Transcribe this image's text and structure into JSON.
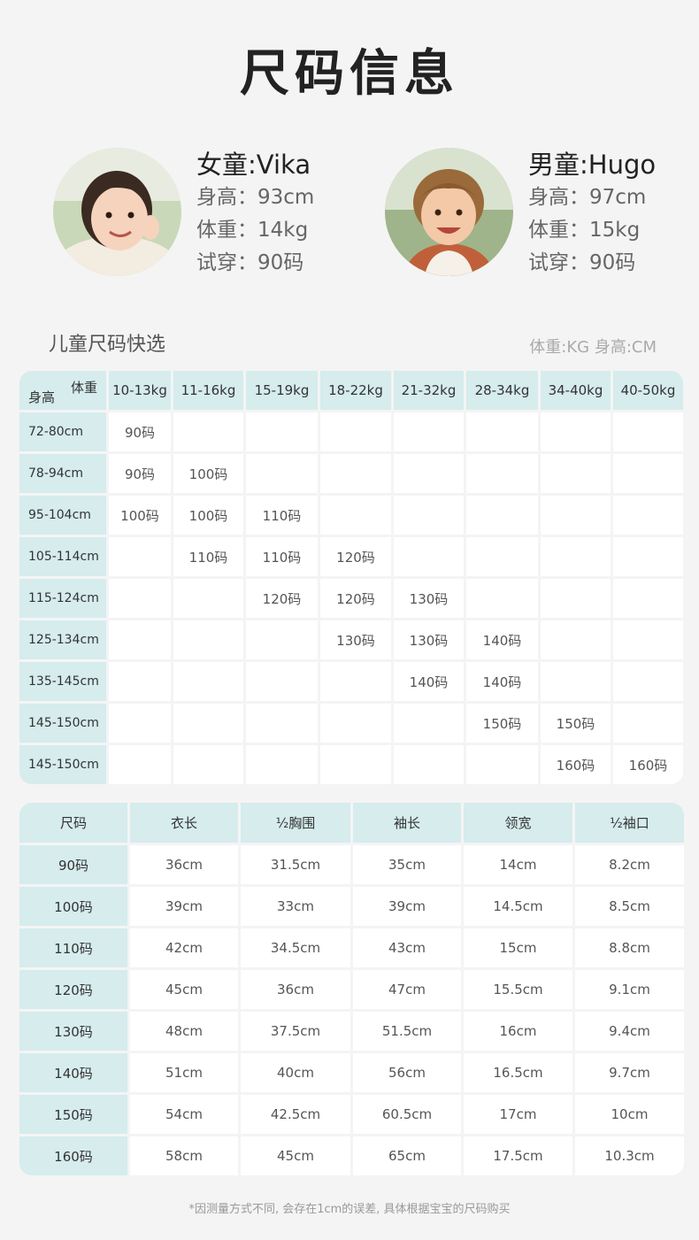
{
  "title": "尺码信息",
  "models": [
    {
      "name": "女童:Vika",
      "height": "身高：93cm",
      "weight": "体重：14kg",
      "tried": "试穿：90码"
    },
    {
      "name": "男童:Hugo",
      "height": "身高：97cm",
      "weight": "体重：15kg",
      "tried": "试穿：90码"
    }
  ],
  "quick": {
    "title": "儿童尺码快选",
    "units": "体重:KG  身高:CM",
    "corner_weight": "体重",
    "corner_height": "身高",
    "weights": [
      "10-13kg",
      "11-16kg",
      "15-19kg",
      "18-22kg",
      "21-32kg",
      "28-34kg",
      "34-40kg",
      "40-50kg"
    ],
    "rows": [
      {
        "height": "72-80cm",
        "cells": [
          "90码",
          "",
          "",
          "",
          "",
          "",
          "",
          ""
        ]
      },
      {
        "height": "78-94cm",
        "cells": [
          "90码",
          "100码",
          "",
          "",
          "",
          "",
          "",
          ""
        ]
      },
      {
        "height": "95-104cm",
        "cells": [
          "100码",
          "100码",
          "110码",
          "",
          "",
          "",
          "",
          ""
        ]
      },
      {
        "height": "105-114cm",
        "cells": [
          "",
          "110码",
          "110码",
          "120码",
          "",
          "",
          "",
          ""
        ]
      },
      {
        "height": "115-124cm",
        "cells": [
          "",
          "",
          "120码",
          "120码",
          "130码",
          "",
          "",
          ""
        ]
      },
      {
        "height": "125-134cm",
        "cells": [
          "",
          "",
          "",
          "130码",
          "130码",
          "140码",
          "",
          ""
        ]
      },
      {
        "height": "135-145cm",
        "cells": [
          "",
          "",
          "",
          "",
          "140码",
          "140码",
          "",
          ""
        ]
      },
      {
        "height": "145-150cm",
        "cells": [
          "",
          "",
          "",
          "",
          "",
          "150码",
          "150码",
          ""
        ]
      },
      {
        "height": "145-150cm",
        "cells": [
          "",
          "",
          "",
          "",
          "",
          "",
          "160码",
          "160码"
        ]
      }
    ]
  },
  "sizes": {
    "headers": [
      "尺码",
      "衣长",
      "½胸围",
      "袖长",
      "领宽",
      "½袖口"
    ],
    "rows": [
      [
        "90码",
        "36cm",
        "31.5cm",
        "35cm",
        "14cm",
        "8.2cm"
      ],
      [
        "100码",
        "39cm",
        "33cm",
        "39cm",
        "14.5cm",
        "8.5cm"
      ],
      [
        "110码",
        "42cm",
        "34.5cm",
        "43cm",
        "15cm",
        "8.8cm"
      ],
      [
        "120码",
        "45cm",
        "36cm",
        "47cm",
        "15.5cm",
        "9.1cm"
      ],
      [
        "130码",
        "48cm",
        "37.5cm",
        "51.5cm",
        "16cm",
        "9.4cm"
      ],
      [
        "140码",
        "51cm",
        "40cm",
        "56cm",
        "16.5cm",
        "9.7cm"
      ],
      [
        "150码",
        "54cm",
        "42.5cm",
        "60.5cm",
        "17cm",
        "10cm"
      ],
      [
        "160码",
        "58cm",
        "45cm",
        "65cm",
        "17.5cm",
        "10.3cm"
      ]
    ]
  },
  "note": "*因测量方式不同, 会存在1cm的误差, 具体根据宝宝的尺码购买"
}
